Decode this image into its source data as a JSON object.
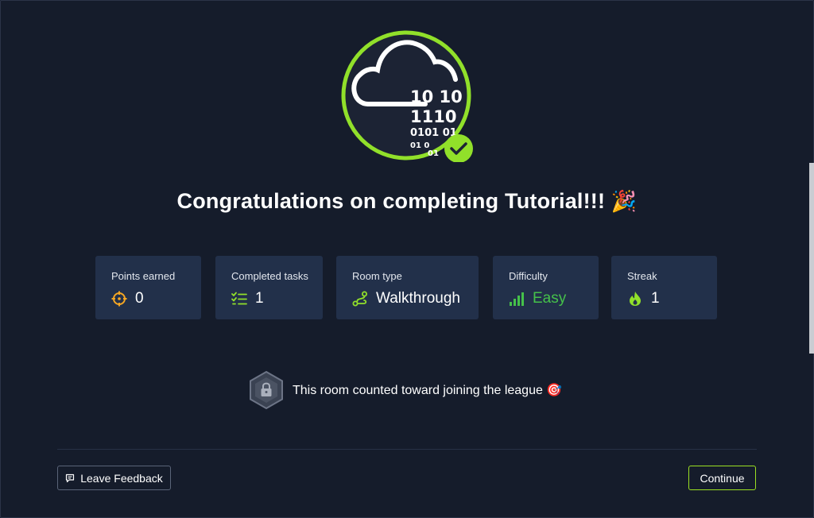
{
  "badge": {
    "icon": "cloud-binary-badge",
    "binary_lines": [
      "10 10",
      "1110",
      "0101 01",
      "01 0",
      "01"
    ],
    "ring_color": "#91e02a",
    "check_color": "#91e02a"
  },
  "title": {
    "text": "Congratulations on completing Tutorial!!!",
    "emoji": "🎉"
  },
  "stats": [
    {
      "label": "Points earned",
      "value": "0",
      "icon": "target-icon",
      "color": "#f5a623"
    },
    {
      "label": "Completed tasks",
      "value": "1",
      "icon": "checklist-icon",
      "color": "#91e02a"
    },
    {
      "label": "Room type",
      "value": "Walkthrough",
      "icon": "path-icon",
      "color": "#91e02a"
    },
    {
      "label": "Difficulty",
      "value": "Easy",
      "icon": "signal-bars-icon",
      "color": "#45c14a"
    },
    {
      "label": "Streak",
      "value": "1",
      "icon": "flame-icon",
      "color": "#91e02a"
    }
  ],
  "league": {
    "text": "This room counted toward joining the league",
    "emoji": "🎯",
    "icon": "locked-hexagon-icon"
  },
  "footer": {
    "feedback_label": "Leave Feedback",
    "continue_label": "Continue"
  }
}
